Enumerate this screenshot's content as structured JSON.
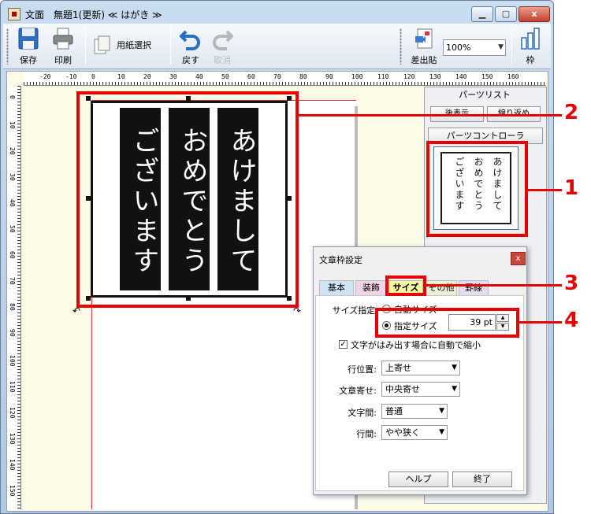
{
  "window": {
    "title": "文面　無題1(更新) ≪ はがき ≫",
    "minimize": "▁",
    "maximize": "▢",
    "close": "x"
  },
  "toolbar": {
    "save_label": "保存",
    "print_label": "印刷",
    "paper_select_label": "用紙選択",
    "undo_label": "戻す",
    "redo_label": "取消",
    "insert_label": "差出貼",
    "zoom_value": "100%",
    "frame_label": "枠"
  },
  "ruler": {
    "top_ticks": [
      "-20",
      "-10",
      "0",
      "10",
      "20",
      "30",
      "40",
      "50",
      "60",
      "70",
      "80",
      "90",
      "100",
      "110",
      "120",
      "130",
      "140",
      "150",
      "160"
    ],
    "left_ticks": [
      "0",
      "10",
      "20",
      "30",
      "40",
      "50",
      "60",
      "70",
      "80",
      "90",
      "100",
      "110",
      "120",
      "130",
      "140",
      "150"
    ]
  },
  "canvas": {
    "columns": [
      "あけまして",
      "おめでとう",
      "ございます"
    ]
  },
  "parts_panel": {
    "title": "パーツリスト",
    "show_button": "後表示",
    "hide_button": "線り返め",
    "control_button": "パーツコントローラ",
    "thumbnail_columns": [
      "あけまして",
      "おめでとう",
      "ございます"
    ]
  },
  "dialog": {
    "title": "文章枠設定",
    "close": "x",
    "tabs": [
      "基本",
      "装飾",
      "サイズ",
      "その他",
      "罫線"
    ],
    "size_spec_label": "サイズ指定:",
    "auto_size_label": "自動サイズ",
    "specified_size_label": "指定サイズ",
    "size_value": "39 pt",
    "auto_shrink_label": "文字がはみ出す場合に自動で縮小",
    "line_position_label": "行位置:",
    "line_position_value": "上寄せ",
    "text_align_label": "文章寄せ:",
    "text_align_value": "中央寄せ",
    "char_spacing_label": "文字間:",
    "char_spacing_value": "普通",
    "line_spacing_label": "行間:",
    "line_spacing_value": "やや狭く",
    "help_button": "ヘルプ",
    "finish_button": "終了"
  },
  "callouts": [
    "1",
    "2",
    "3",
    "4"
  ],
  "colors": {
    "callout": "#e60000",
    "selected_tab": "#f7f7a0",
    "tab_basic": "#cfe3f7",
    "tab_decoration": "#f3d4e6"
  }
}
